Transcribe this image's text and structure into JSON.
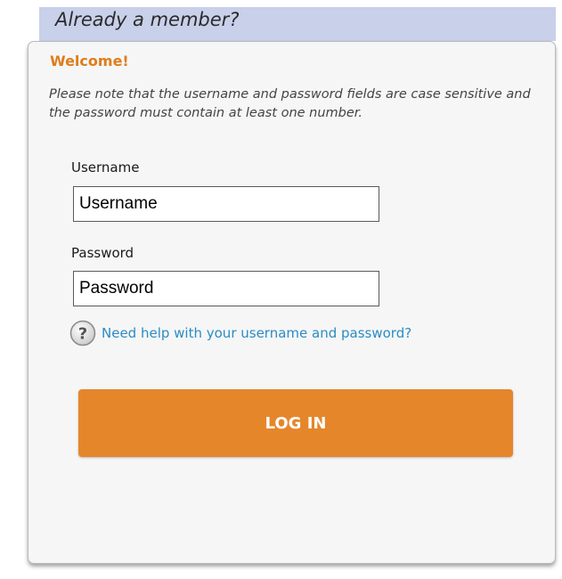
{
  "header": {
    "title": "Already a member?"
  },
  "panel": {
    "welcome": "Welcome!",
    "note": "Please note that the username and password fields are case sensitive and the password must contain at least one number."
  },
  "form": {
    "username_label": "Username",
    "username_placeholder": "Username",
    "password_label": "Password",
    "password_placeholder": "Password",
    "help_link": "Need help with your username and password?",
    "login_label": "LOG IN"
  },
  "icons": {
    "help": "question-mark-circle-icon"
  },
  "colors": {
    "accent": "#e5862b",
    "welcome": "#e07d1a",
    "link": "#2a8cc4",
    "header_band": "#c8d0ea",
    "panel_bg": "#f6f6f6"
  }
}
